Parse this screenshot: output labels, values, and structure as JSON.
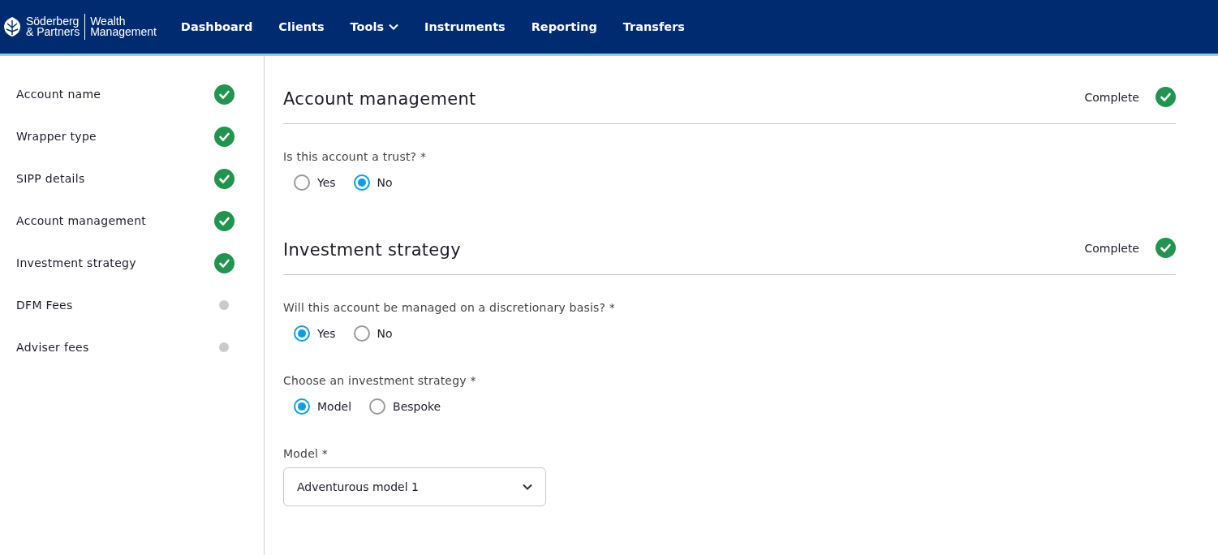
{
  "header": {
    "logo": {
      "name_lines": [
        "Söderberg",
        "& Partners"
      ],
      "division_lines": [
        "Wealth",
        "Management"
      ]
    },
    "nav": [
      {
        "label": "Dashboard",
        "has_menu": false
      },
      {
        "label": "Clients",
        "has_menu": false
      },
      {
        "label": "Tools",
        "has_menu": true
      },
      {
        "label": "Instruments",
        "has_menu": false
      },
      {
        "label": "Reporting",
        "has_menu": false
      },
      {
        "label": "Transfers",
        "has_menu": false
      }
    ]
  },
  "sidebar": {
    "steps": [
      {
        "label": "Account name",
        "complete": true
      },
      {
        "label": "Wrapper type",
        "complete": true
      },
      {
        "label": "SIPP details",
        "complete": true
      },
      {
        "label": "Account management",
        "complete": true
      },
      {
        "label": "Investment strategy",
        "complete": true
      },
      {
        "label": "DFM Fees",
        "complete": false
      },
      {
        "label": "Adviser fees",
        "complete": false
      }
    ]
  },
  "sections": [
    {
      "title": "Account management",
      "status": "Complete",
      "complete": true,
      "questions": [
        {
          "kind": "radio",
          "label": "Is this account a trust?",
          "required": "*",
          "options": [
            {
              "label": "Yes",
              "selected": false
            },
            {
              "label": "No",
              "selected": true
            }
          ]
        }
      ]
    },
    {
      "title": "Investment strategy",
      "status": "Complete",
      "complete": true,
      "questions": [
        {
          "kind": "radio",
          "label": "Will this account be managed on a discretionary basis?",
          "required": "*",
          "options": [
            {
              "label": "Yes",
              "selected": true
            },
            {
              "label": "No",
              "selected": false
            }
          ]
        },
        {
          "kind": "radio",
          "label": "Choose an investment strategy",
          "required": "*",
          "options": [
            {
              "label": "Model",
              "selected": true
            },
            {
              "label": "Bespoke",
              "selected": false
            }
          ]
        },
        {
          "kind": "select",
          "label": "Model",
          "required": "*",
          "value": "Adventurous model 1"
        }
      ]
    }
  ]
}
